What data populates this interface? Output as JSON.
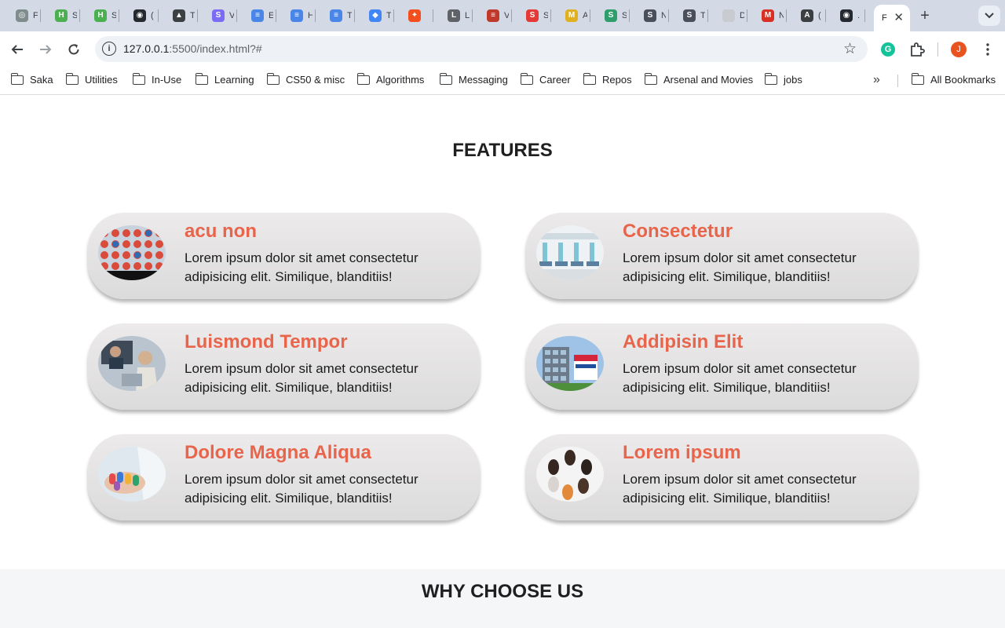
{
  "browser": {
    "tabs": [
      {
        "icon": "openai-icon",
        "color": "#7f8c8d",
        "glyph": "◎",
        "title": "F"
      },
      {
        "icon": "gpt-icon",
        "color": "#4caf50",
        "glyph": "H",
        "title": "S"
      },
      {
        "icon": "gpt-icon",
        "color": "#4caf50",
        "glyph": "H",
        "title": "S"
      },
      {
        "icon": "github-icon",
        "color": "#24292f",
        "glyph": "◉",
        "title": "("
      },
      {
        "icon": "triangle-icon",
        "color": "#3c4043",
        "glyph": "▲",
        "title": "T"
      },
      {
        "icon": "s-icon",
        "color": "#7b6cf6",
        "glyph": "S",
        "title": "V"
      },
      {
        "icon": "docs-icon",
        "color": "#4a86e8",
        "glyph": "≡",
        "title": "E"
      },
      {
        "icon": "docs-icon",
        "color": "#4a86e8",
        "glyph": "≡",
        "title": "H"
      },
      {
        "icon": "docs-icon",
        "color": "#4a86e8",
        "glyph": "≡",
        "title": "T"
      },
      {
        "icon": "diamond-icon",
        "color": "#4285f4",
        "glyph": "◆",
        "title": "T"
      },
      {
        "icon": "figma-icon",
        "color": "#f24e1e",
        "glyph": "✦",
        "title": ""
      },
      {
        "icon": "l-icon",
        "color": "#5f6368",
        "glyph": "L",
        "title": "L"
      },
      {
        "icon": "flag-icon",
        "color": "#c0392b",
        "glyph": "≡",
        "title": "V"
      },
      {
        "icon": "s-red-icon",
        "color": "#e53935",
        "glyph": "S",
        "title": "S"
      },
      {
        "icon": "m-yellow-icon",
        "color": "#e0b020",
        "glyph": "M",
        "title": "A"
      },
      {
        "icon": "s-green-icon",
        "color": "#2e9e6b",
        "glyph": "S",
        "title": "S"
      },
      {
        "icon": "s-dark-icon",
        "color": "#4a4f5c",
        "glyph": "S",
        "title": "N"
      },
      {
        "icon": "s-dark-icon",
        "color": "#4a4f5c",
        "glyph": "S",
        "title": "T"
      },
      {
        "icon": "blank-icon",
        "color": "#c8ccd2",
        "glyph": "",
        "title": "D"
      },
      {
        "icon": "gmail-icon",
        "color": "#d93025",
        "glyph": "M",
        "title": "N"
      },
      {
        "icon": "code-icon",
        "color": "#3c4043",
        "glyph": "A",
        "title": "("
      },
      {
        "icon": "github-icon",
        "color": "#24292f",
        "glyph": "◉",
        "title": "."
      }
    ],
    "active_tab": {
      "title": "F",
      "close": "✕"
    },
    "new_tab": "+",
    "tab_search": "⌄",
    "nav": {
      "back": "←",
      "forward": "→",
      "reload": "↻"
    },
    "url": {
      "host": "127.0.0.1",
      "rest": ":5500/index.html?#"
    },
    "profile_initial": "J",
    "grammarly": "G",
    "bookmarks": [
      "Saka",
      "Utilities",
      "In-Use",
      "Learning",
      "CS50 & misc",
      "Algorithms",
      "Messaging",
      "Career",
      "Repos",
      "Arsenal and Movies",
      "jobs"
    ],
    "bookmarks_more": "»",
    "all_bookmarks": "All Bookmarks"
  },
  "page": {
    "features_title": "FEATURES",
    "features": [
      {
        "title": "acu non",
        "desc": "Lorem ipsum dolor sit amet consectetur adipisicing elit. Similique, blanditiis!",
        "image": "pills-blister-image"
      },
      {
        "title": "Consectetur",
        "desc": "Lorem ipsum dolor sit amet consectetur adipisicing elit. Similique, blanditiis!",
        "image": "hospital-ward-image"
      },
      {
        "title": "Luismond Tempor",
        "desc": "Lorem ipsum dolor sit amet consectetur adipisicing elit. Similique, blanditiis!",
        "image": "video-consultation-image"
      },
      {
        "title": "Addipisin Elit",
        "desc": "Lorem ipsum dolor sit amet consectetur adipisicing elit. Similique, blanditiis!",
        "image": "hospital-building-image"
      },
      {
        "title": "Dolore Magna Aliqua",
        "desc": "Lorem ipsum dolor sit amet consectetur adipisicing elit. Similique, blanditiis!",
        "image": "hand-pills-image"
      },
      {
        "title": "Lorem ipsum",
        "desc": "Lorem ipsum dolor sit amet consectetur adipisicing elit. Similique, blanditiis!",
        "image": "capsules-circle-image"
      }
    ],
    "why_title": "WHY CHOOSE US"
  }
}
